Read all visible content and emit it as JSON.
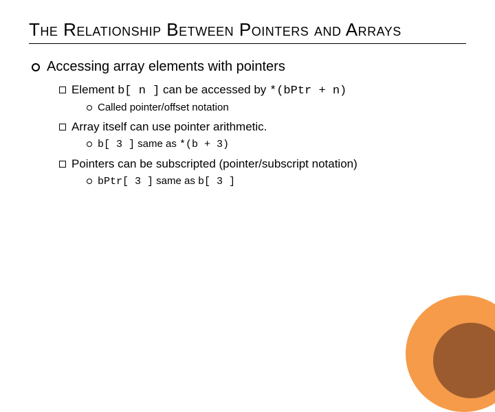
{
  "title": "The Relationship Between Pointers and Arrays",
  "lvl1": {
    "text": "Accessing array elements with pointers"
  },
  "lvl2a": {
    "pre": "Element ",
    "code1": "b[ n ]",
    "mid": " can be accessed by ",
    "code2": "*(bPtr + n)"
  },
  "lvl3a": {
    "text": "Called pointer/offset notation"
  },
  "lvl2b": {
    "text": "Array itself can use pointer arithmetic."
  },
  "lvl3b": {
    "code1": "b[ 3 ]",
    "mid": " same as ",
    "code2": "*(b + 3)"
  },
  "lvl2c": {
    "text": "Pointers can be subscripted (pointer/subscript notation)"
  },
  "lvl3c": {
    "code1": "bPtr[ 3 ]",
    "mid": " same as ",
    "code2": "b[ 3 ]"
  }
}
